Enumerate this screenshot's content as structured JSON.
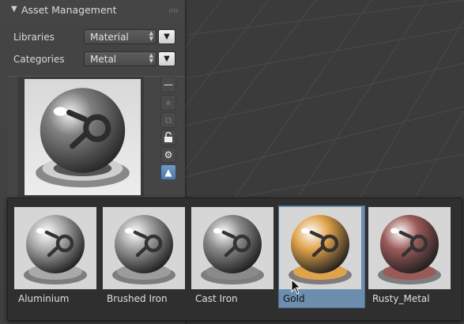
{
  "panel": {
    "title": "Asset Management",
    "libraries": {
      "label": "Libraries",
      "value": "Material"
    },
    "categories": {
      "label": "Categories",
      "value": "Metal"
    }
  },
  "side_buttons": [
    "minus-icon",
    "star-icon",
    "copy-icon",
    "lock-icon",
    "gear-icon",
    "chevron-up-icon"
  ],
  "assets": [
    {
      "name": "Aluminium",
      "color": "#a9a9a9",
      "selected": false
    },
    {
      "name": "Brushed Iron",
      "color": "#9c9c9c",
      "selected": false
    },
    {
      "name": "Cast Iron",
      "color": "#8a8a8a",
      "selected": false
    },
    {
      "name": "Gold",
      "color": "#e0a24a",
      "selected": true
    },
    {
      "name": "Rusty_Metal",
      "color": "#9a5a58",
      "selected": false
    }
  ],
  "colors": {
    "selected_tile": "#6b8eaf",
    "active_button": "#5a86b2"
  }
}
